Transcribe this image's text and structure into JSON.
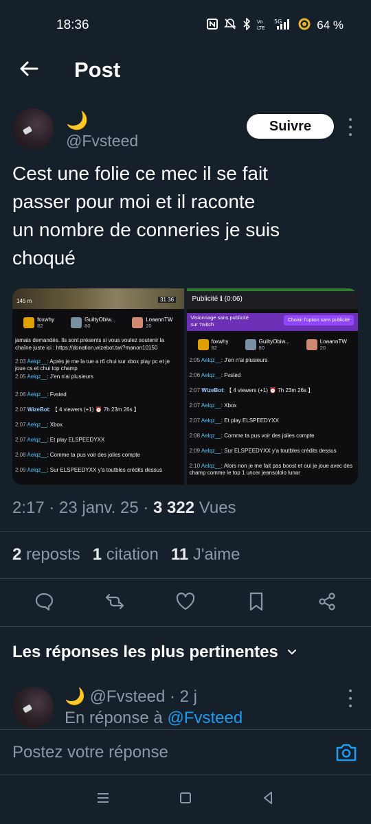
{
  "status_bar": {
    "time": "18:36",
    "battery_percent": "64 %",
    "icons": [
      "nfc-icon",
      "mute-icon",
      "bluetooth-icon",
      "volte-icon",
      "5g-signal-icon",
      "battery-icon"
    ],
    "network": "5G"
  },
  "header": {
    "title": "Post"
  },
  "post": {
    "display_name": "🌙",
    "handle": "@Fvsteed",
    "follow_label": "Suivre",
    "text": "Cest une folie ce mec il se fait\npasser pour moi et il raconte\nun nombre de conneries je suis\nchoqué",
    "meta_time": "2:17 · 23 janv. 25 · ",
    "views_count": "3 322",
    "views_label": " Vues",
    "stats": {
      "reposts_count": "2",
      "reposts_label": "reposts",
      "quotes_count": "1",
      "quotes_label": "citation",
      "likes_count": "11",
      "likes_label": "J'aime"
    }
  },
  "media": {
    "left": {
      "hud_left": "145 m",
      "hud_right": "31 36",
      "subs": [
        {
          "name": "foxwhy",
          "count": "82"
        },
        {
          "name": "GuiltyObiw...",
          "count": "80"
        },
        {
          "name": "LoaannTW",
          "count": "20"
        }
      ],
      "intro": "jamais demandés. Ils sont présents si vous voulez soutenir la chaîne juste ici : https://donation.wizebot.tw/?manon10150",
      "chat": [
        {
          "t": "2:03",
          "u": "Aelqz__",
          "m": ": Après je me la tue a r6 chui sur xbox play pc et je joue cs et chui top champ"
        },
        {
          "t": "2:05",
          "u": "Aelqz__",
          "m": ": J'en n'ai plusieurs"
        },
        {
          "t": "2:06",
          "u": "Aelqz__",
          "m": ": Fvsted"
        },
        {
          "t": "2:07",
          "u": "WizeBot",
          "m": ": 【 4 viewers (+1) ⏰ 7h 23m 26s 】"
        },
        {
          "t": "2:07",
          "u": "Aelqz__",
          "m": ": Xbox"
        },
        {
          "t": "2:07",
          "u": "Aelqz__",
          "m": ": Et play ELSPEEDYXX"
        },
        {
          "t": "2:08",
          "u": "Aelqz__",
          "m": ": Comme ta pus voir des jolies compte"
        },
        {
          "t": "2:09",
          "u": "Aelqz__",
          "m": ": Sur ELSPEEDYXX y'a toutbles crédits dessus"
        }
      ]
    },
    "right": {
      "ad_title": "Publicité ℹ (0:06)",
      "ad_promo": "Visionnage sans publicité sur Twitch",
      "ad_button": "Choisir l'option sans publicité",
      "subs": [
        {
          "name": "foxwhy",
          "count": "82"
        },
        {
          "name": "GuiltyObiw...",
          "count": "80"
        },
        {
          "name": "LoaannTW",
          "count": "20"
        }
      ],
      "chat": [
        {
          "t": "2:05",
          "u": "Aelqz__",
          "m": ": J'en n'ai plusieurs"
        },
        {
          "t": "2:06",
          "u": "Aelqz__",
          "m": ": Fvsted"
        },
        {
          "t": "2:07",
          "u": "WizeBot",
          "m": ": 【 4 viewers (+1) ⏰ 7h 23m 26s 】"
        },
        {
          "t": "2:07",
          "u": "Aelqz__",
          "m": ": Xbox"
        },
        {
          "t": "2:07",
          "u": "Aelqz__",
          "m": ": Et play ELSPEEDYXX"
        },
        {
          "t": "2:08",
          "u": "Aelqz__",
          "m": ": Comme ta pus voir des jolies compte"
        },
        {
          "t": "2:09",
          "u": "Aelqz__",
          "m": ": Sur ELSPEEDYXX y'a toutbles crédits dessus"
        },
        {
          "t": "2:10",
          "u": "Aelqz__",
          "m": ": Alors non je me fait pas boost et oui je joue avec des champ comme le top 1 uncer jeansololo lunar"
        }
      ]
    }
  },
  "actions": [
    "reply-icon",
    "repost-icon",
    "like-icon",
    "bookmark-icon",
    "share-icon"
  ],
  "replies": {
    "sort_label": "Les réponses les plus pertinentes",
    "first": {
      "display_name": "🌙",
      "handle_time": "@Fvsteed · 2 j",
      "reply_prefix": "En réponse à ",
      "reply_handle": "@Fvsteed"
    }
  },
  "composer": {
    "placeholder": "Postez votre réponse"
  },
  "colors": {
    "background": "#15202b",
    "accent": "#1d9bf0",
    "muted": "#8b98a5",
    "divider": "#38444d"
  }
}
